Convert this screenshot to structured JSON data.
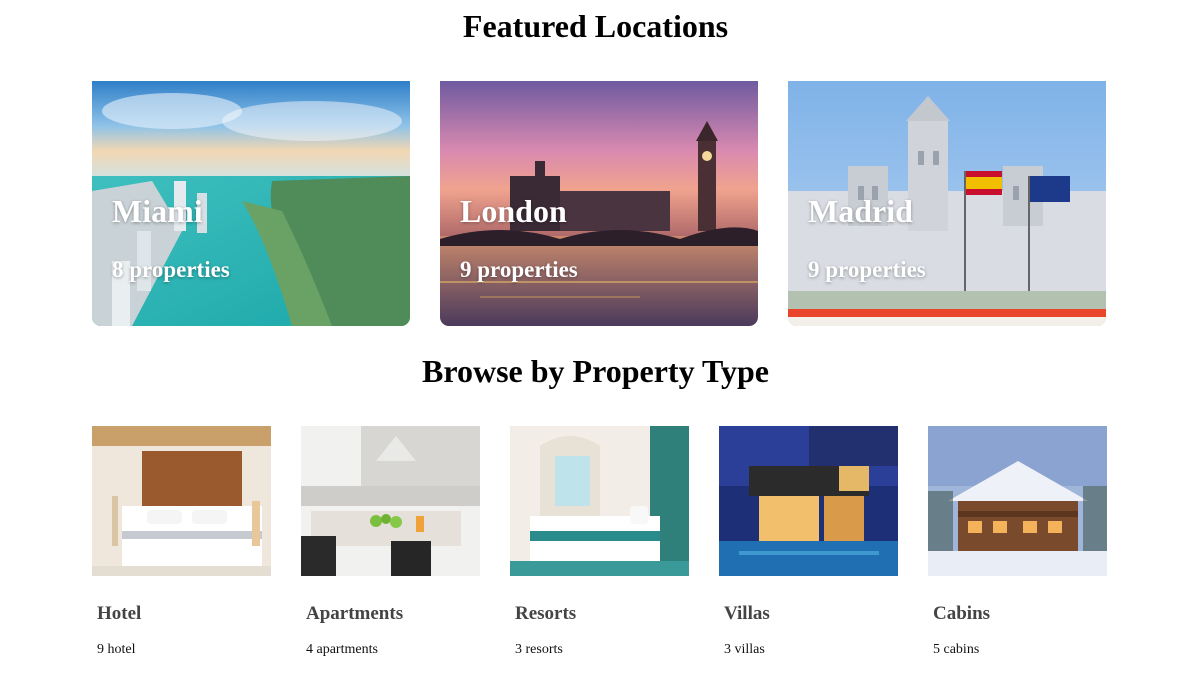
{
  "featured": {
    "title": "Featured Locations",
    "cards": [
      {
        "city": "Miami",
        "count": "8 properties"
      },
      {
        "city": "London",
        "count": "9 properties"
      },
      {
        "city": "Madrid",
        "count": "9 properties"
      }
    ]
  },
  "browse": {
    "title": "Browse by Property Type",
    "types": [
      {
        "name": "Hotel",
        "count": "9 hotel"
      },
      {
        "name": "Apartments",
        "count": "4 apartments"
      },
      {
        "name": "Resorts",
        "count": "3 resorts"
      },
      {
        "name": "Villas",
        "count": "3 villas"
      },
      {
        "name": "Cabins",
        "count": "5 cabins"
      }
    ]
  }
}
